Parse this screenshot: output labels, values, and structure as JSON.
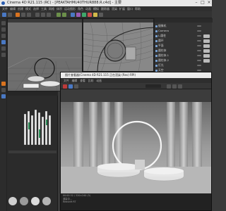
{
  "window": {
    "title": "Cinema 4D R21.115 (RC) - [PEAKTAHMU40THUR888.R.c4d] - 主要"
  },
  "menubar": {
    "items": [
      "文件",
      "编辑",
      "创建",
      "模式",
      "选择",
      "工具",
      "网格",
      "体积",
      "运动图形",
      "角色",
      "动画",
      "模拟",
      "跟踪器",
      "渲染",
      "扩展",
      "窗口",
      "帮助"
    ]
  },
  "object_manager": {
    "items": [
      {
        "label": "摄像机"
      },
      {
        "label": "Camera"
      },
      {
        "label": "L-圆柱"
      },
      {
        "label": "圆环"
      },
      {
        "label": "平面"
      },
      {
        "label": "圆柱体"
      },
      {
        "label": "圆柱体.1"
      },
      {
        "label": "圆柱体.2"
      },
      {
        "label": "灯光"
      },
      {
        "label": "天空"
      }
    ]
  },
  "render_window": {
    "title": "图片查看器(Cinema 4D R21.115 正在渲染 (Rev) RPI)",
    "menu": [
      "文件",
      "编辑",
      "查看",
      "比较",
      "动画"
    ],
    "status": {
      "line1": "00:00:32 / 320×240 (5)",
      "line2": "渲染中...",
      "line3": "Redshift RT"
    }
  },
  "colors": {
    "accent_orange": "#d9731f",
    "accent_blue": "#4a79c4"
  }
}
